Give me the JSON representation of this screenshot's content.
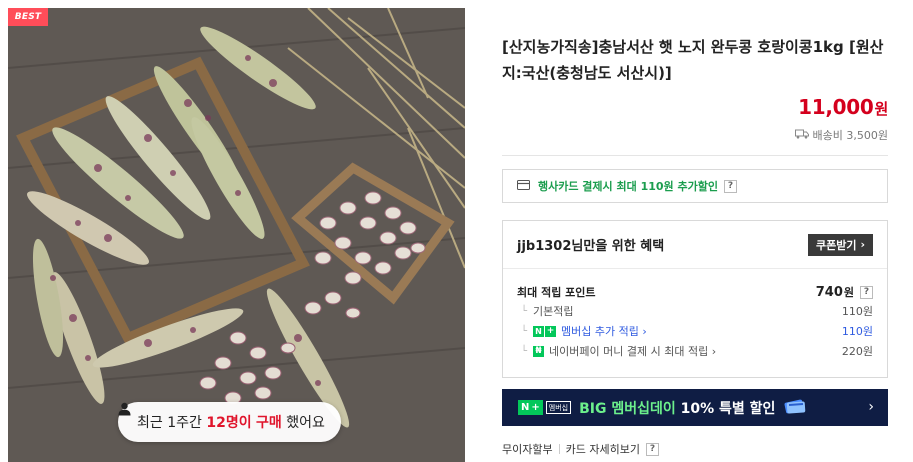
{
  "image": {
    "badge": "BEST",
    "buyers_prefix": "최근 1주간",
    "buyers_count": "12명이",
    "buyers_action": "구매",
    "buyers_suffix": "했어요"
  },
  "product": {
    "title": "[산지농가직송]충남서산 햇 노지 완두콩 호랑이콩1kg [원산지:국산(충청남도 서산시)]",
    "price": "11,000",
    "price_unit": "원",
    "shipping": "배송비 3,500원"
  },
  "card_discount": {
    "text": "행사카드 결제시 최대 110원 추가할인",
    "help": "?"
  },
  "benefit": {
    "title": "jjb1302님만을 위한 혜택",
    "coupon_button": "쿠폰받기",
    "max_point_label": "최대 적립 포인트",
    "max_point_value": "740",
    "max_point_unit": "원",
    "help": "?",
    "rows": [
      {
        "label": "기본적립",
        "value": "110원"
      },
      {
        "label": "멤버십 추가 적립",
        "value": "110원"
      },
      {
        "label": "네이버페이 머니 결제 시 최대 적립",
        "value": "220원"
      }
    ]
  },
  "promo": {
    "n_label": "N",
    "plus_label": "+",
    "member_tag": "멤버십",
    "text_green": "BIG 멤버십데이",
    "text_white": " 10% 특별 할인"
  },
  "bottom": {
    "link1": "무이자할부",
    "link2": "카드 자세히보기",
    "help": "?"
  },
  "colors": {
    "price_red": "#d4001d",
    "naver_green": "#03c75a",
    "card_green": "#1b9d4e",
    "banner_navy": "#0f1d44",
    "link_blue": "#2f5be0"
  }
}
